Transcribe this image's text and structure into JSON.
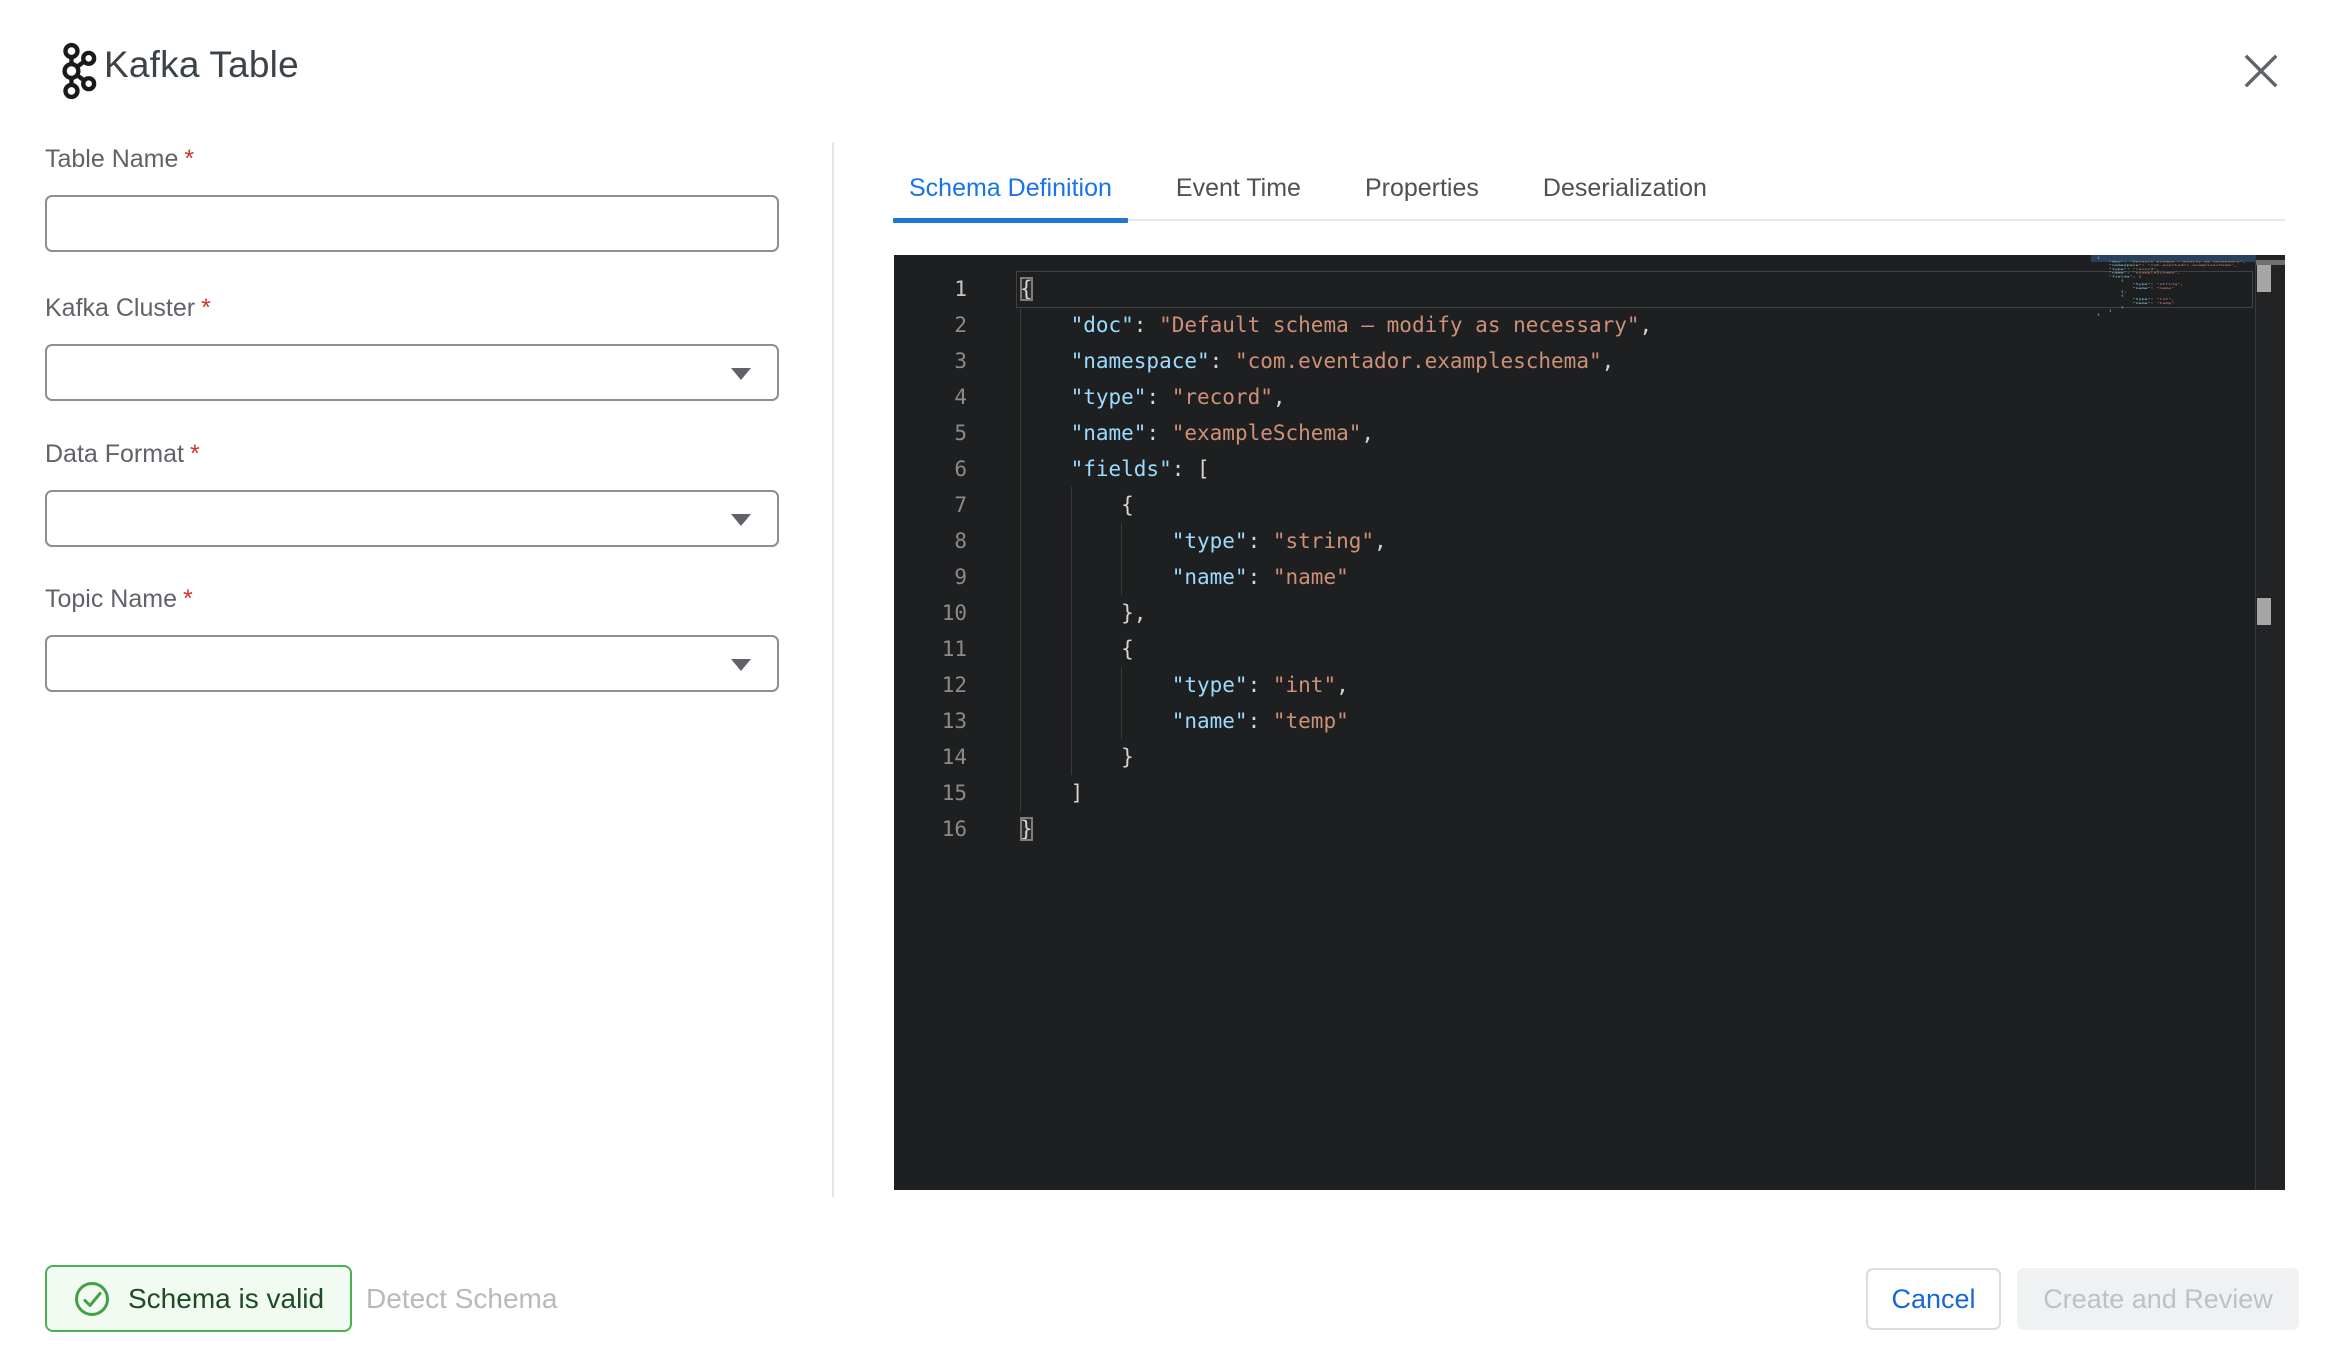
{
  "header": {
    "title": "Kafka Table"
  },
  "form": {
    "fields": [
      {
        "label": "Table Name",
        "required": "*",
        "control": "input",
        "value": ""
      },
      {
        "label": "Kafka Cluster",
        "required": "*",
        "control": "select",
        "value": ""
      },
      {
        "label": "Data Format",
        "required": "*",
        "control": "select",
        "value": ""
      },
      {
        "label": "Topic Name",
        "required": "*",
        "control": "select",
        "value": ""
      }
    ]
  },
  "tabs": [
    {
      "label": "Schema Definition",
      "active": true
    },
    {
      "label": "Event Time",
      "active": false
    },
    {
      "label": "Properties",
      "active": false
    },
    {
      "label": "Deserialization",
      "active": false
    }
  ],
  "editor": {
    "language": "json",
    "active_line": 1,
    "lines": [
      [
        [
          "b",
          "{"
        ]
      ],
      [
        [
          "p",
          "    "
        ],
        [
          "k",
          "\"doc\""
        ],
        [
          "p",
          ": "
        ],
        [
          "s",
          "\"Default schema — modify as necessary\""
        ],
        [
          "p",
          ","
        ]
      ],
      [
        [
          "p",
          "    "
        ],
        [
          "k",
          "\"namespace\""
        ],
        [
          "p",
          ": "
        ],
        [
          "s",
          "\"com.eventador.exampleschema\""
        ],
        [
          "p",
          ","
        ]
      ],
      [
        [
          "p",
          "    "
        ],
        [
          "k",
          "\"type\""
        ],
        [
          "p",
          ": "
        ],
        [
          "s",
          "\"record\""
        ],
        [
          "p",
          ","
        ]
      ],
      [
        [
          "p",
          "    "
        ],
        [
          "k",
          "\"name\""
        ],
        [
          "p",
          ": "
        ],
        [
          "s",
          "\"exampleSchema\""
        ],
        [
          "p",
          ","
        ]
      ],
      [
        [
          "p",
          "    "
        ],
        [
          "k",
          "\"fields\""
        ],
        [
          "p",
          ": ["
        ]
      ],
      [
        [
          "p",
          "        {"
        ]
      ],
      [
        [
          "p",
          "            "
        ],
        [
          "k",
          "\"type\""
        ],
        [
          "p",
          ": "
        ],
        [
          "s",
          "\"string\""
        ],
        [
          "p",
          ","
        ]
      ],
      [
        [
          "p",
          "            "
        ],
        [
          "k",
          "\"name\""
        ],
        [
          "p",
          ": "
        ],
        [
          "s",
          "\"name\""
        ]
      ],
      [
        [
          "p",
          "        },"
        ]
      ],
      [
        [
          "p",
          "        {"
        ]
      ],
      [
        [
          "p",
          "            "
        ],
        [
          "k",
          "\"type\""
        ],
        [
          "p",
          ": "
        ],
        [
          "s",
          "\"int\""
        ],
        [
          "p",
          ","
        ]
      ],
      [
        [
          "p",
          "            "
        ],
        [
          "k",
          "\"name\""
        ],
        [
          "p",
          ": "
        ],
        [
          "s",
          "\"temp\""
        ]
      ],
      [
        [
          "p",
          "        }"
        ]
      ],
      [
        [
          "p",
          "    ]"
        ]
      ],
      [
        [
          "b",
          "}"
        ]
      ]
    ]
  },
  "footer": {
    "status_label": "Schema is valid",
    "detect_label": "Detect Schema",
    "cancel_label": "Cancel",
    "create_label": "Create and Review"
  },
  "colors": {
    "accent_blue": "#1a73e8",
    "valid_green": "#4caf50",
    "editor_bg": "#1e1f20",
    "code_key": "#9cdcfe",
    "code_string": "#ce9178",
    "code_default": "#d4d4d4"
  }
}
